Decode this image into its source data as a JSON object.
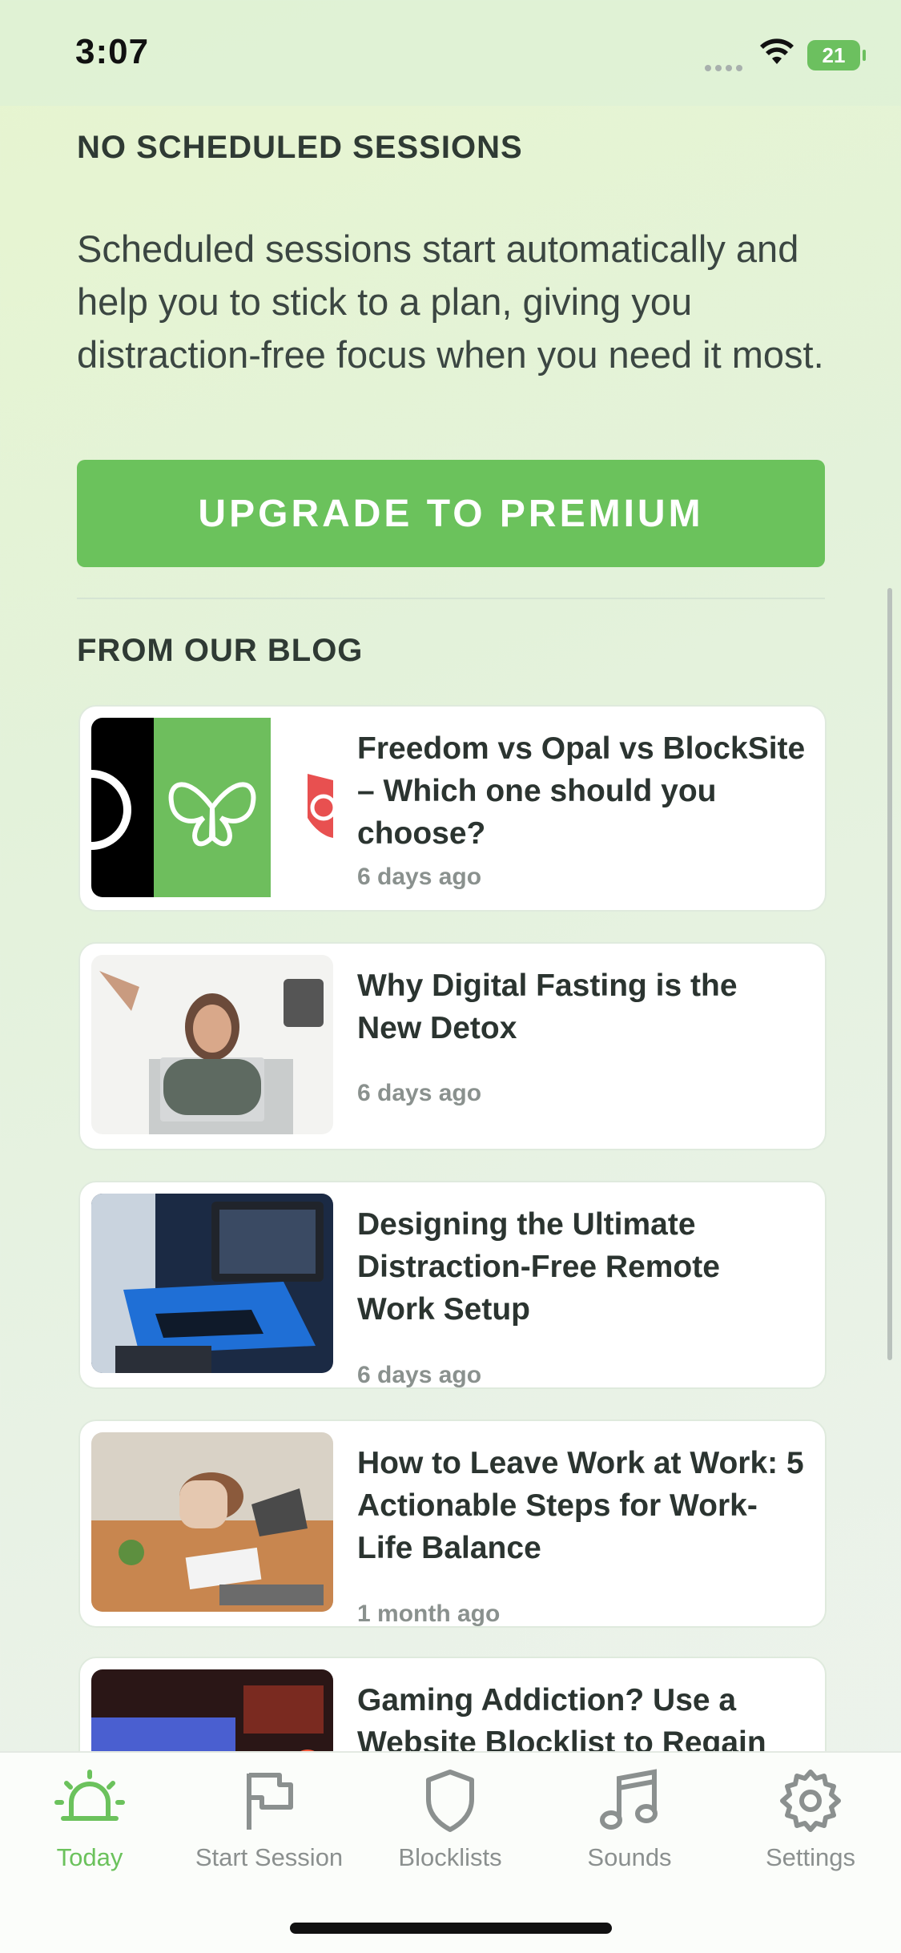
{
  "status_bar": {
    "time": "3:07",
    "battery": "21"
  },
  "scheduled": {
    "title": "NO SCHEDULED SESSIONS",
    "description": "Scheduled sessions start automatically and help you to stick to a plan, giving you distraction-free focus when you need it most.",
    "button_label": "UPGRADE TO PREMIUM"
  },
  "blog": {
    "title": "FROM OUR BLOG",
    "posts": [
      {
        "title": "Freedom vs Opal vs BlockSite – Which one should you choose?",
        "time": "6 days ago"
      },
      {
        "title": "Why Digital Fasting is the New Detox",
        "time": "6 days ago"
      },
      {
        "title": "Designing the Ultimate Distraction-Free Remote Work Setup",
        "time": "6 days ago"
      },
      {
        "title": "How to Leave Work at Work: 5 Actionable Steps for Work-Life Balance",
        "time": "1 month ago"
      },
      {
        "title": "Gaming Addiction? Use a Website Blocklist to Regain",
        "time": ""
      }
    ]
  },
  "tabs": [
    {
      "label": "Today",
      "icon": "sun-alarm-icon",
      "active": true
    },
    {
      "label": "Start Session",
      "icon": "flag-icon",
      "active": false
    },
    {
      "label": "Blocklists",
      "icon": "shield-icon",
      "active": false
    },
    {
      "label": "Sounds",
      "icon": "music-note-icon",
      "active": false
    },
    {
      "label": "Settings",
      "icon": "gear-icon",
      "active": false
    }
  ],
  "colors": {
    "accent": "#6bc25c",
    "text": "#2f3a34",
    "muted": "#8a918e"
  }
}
